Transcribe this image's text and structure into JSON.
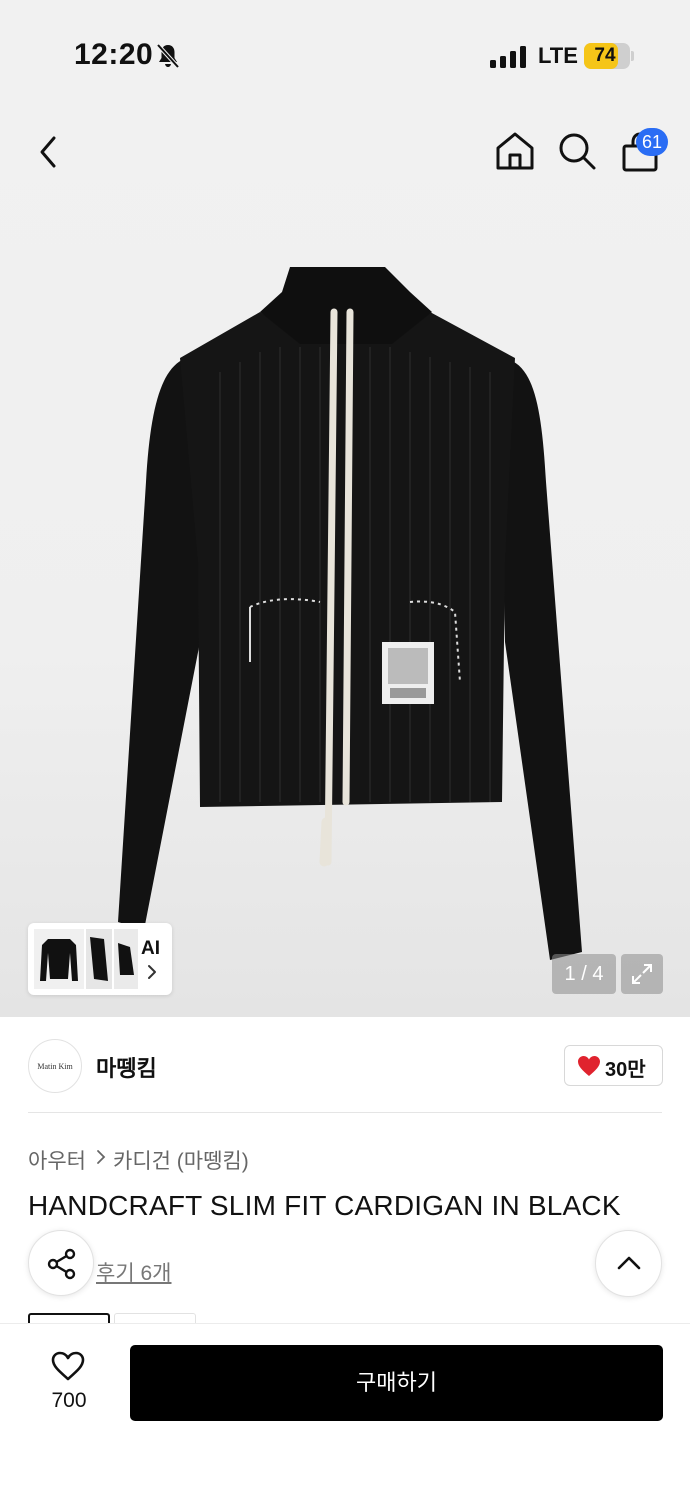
{
  "status_bar": {
    "time": "12:20",
    "network": "LTE",
    "battery_level": "74",
    "battery_fraction": 0.74,
    "icons": [
      "bell-off-icon",
      "signal-icon"
    ]
  },
  "header": {
    "icons": [
      "back-icon",
      "home-icon",
      "search-icon",
      "shopping-bag-icon"
    ],
    "cart_badge": "61"
  },
  "gallery": {
    "ai_label": "AI",
    "counter": "1 / 4",
    "icons": [
      "chevron-right-icon",
      "expand-icon"
    ]
  },
  "brand": {
    "logo_text": "Matin Kim",
    "name": "마뗑킴",
    "likes": "30만"
  },
  "product": {
    "category": "아우터",
    "subcategory": "카디건 (마뗑킴)",
    "title": "HANDCRAFT SLIM FIT CARDIGAN IN BLACK",
    "reviews": "후기 6개"
  },
  "bottom_bar": {
    "wish_count": "700",
    "buy_label": "구매하기"
  },
  "colors": {
    "accent": "#2a6df4",
    "battery": "#f5c518",
    "heart": "#e0232e",
    "buy_button": "#000000"
  }
}
